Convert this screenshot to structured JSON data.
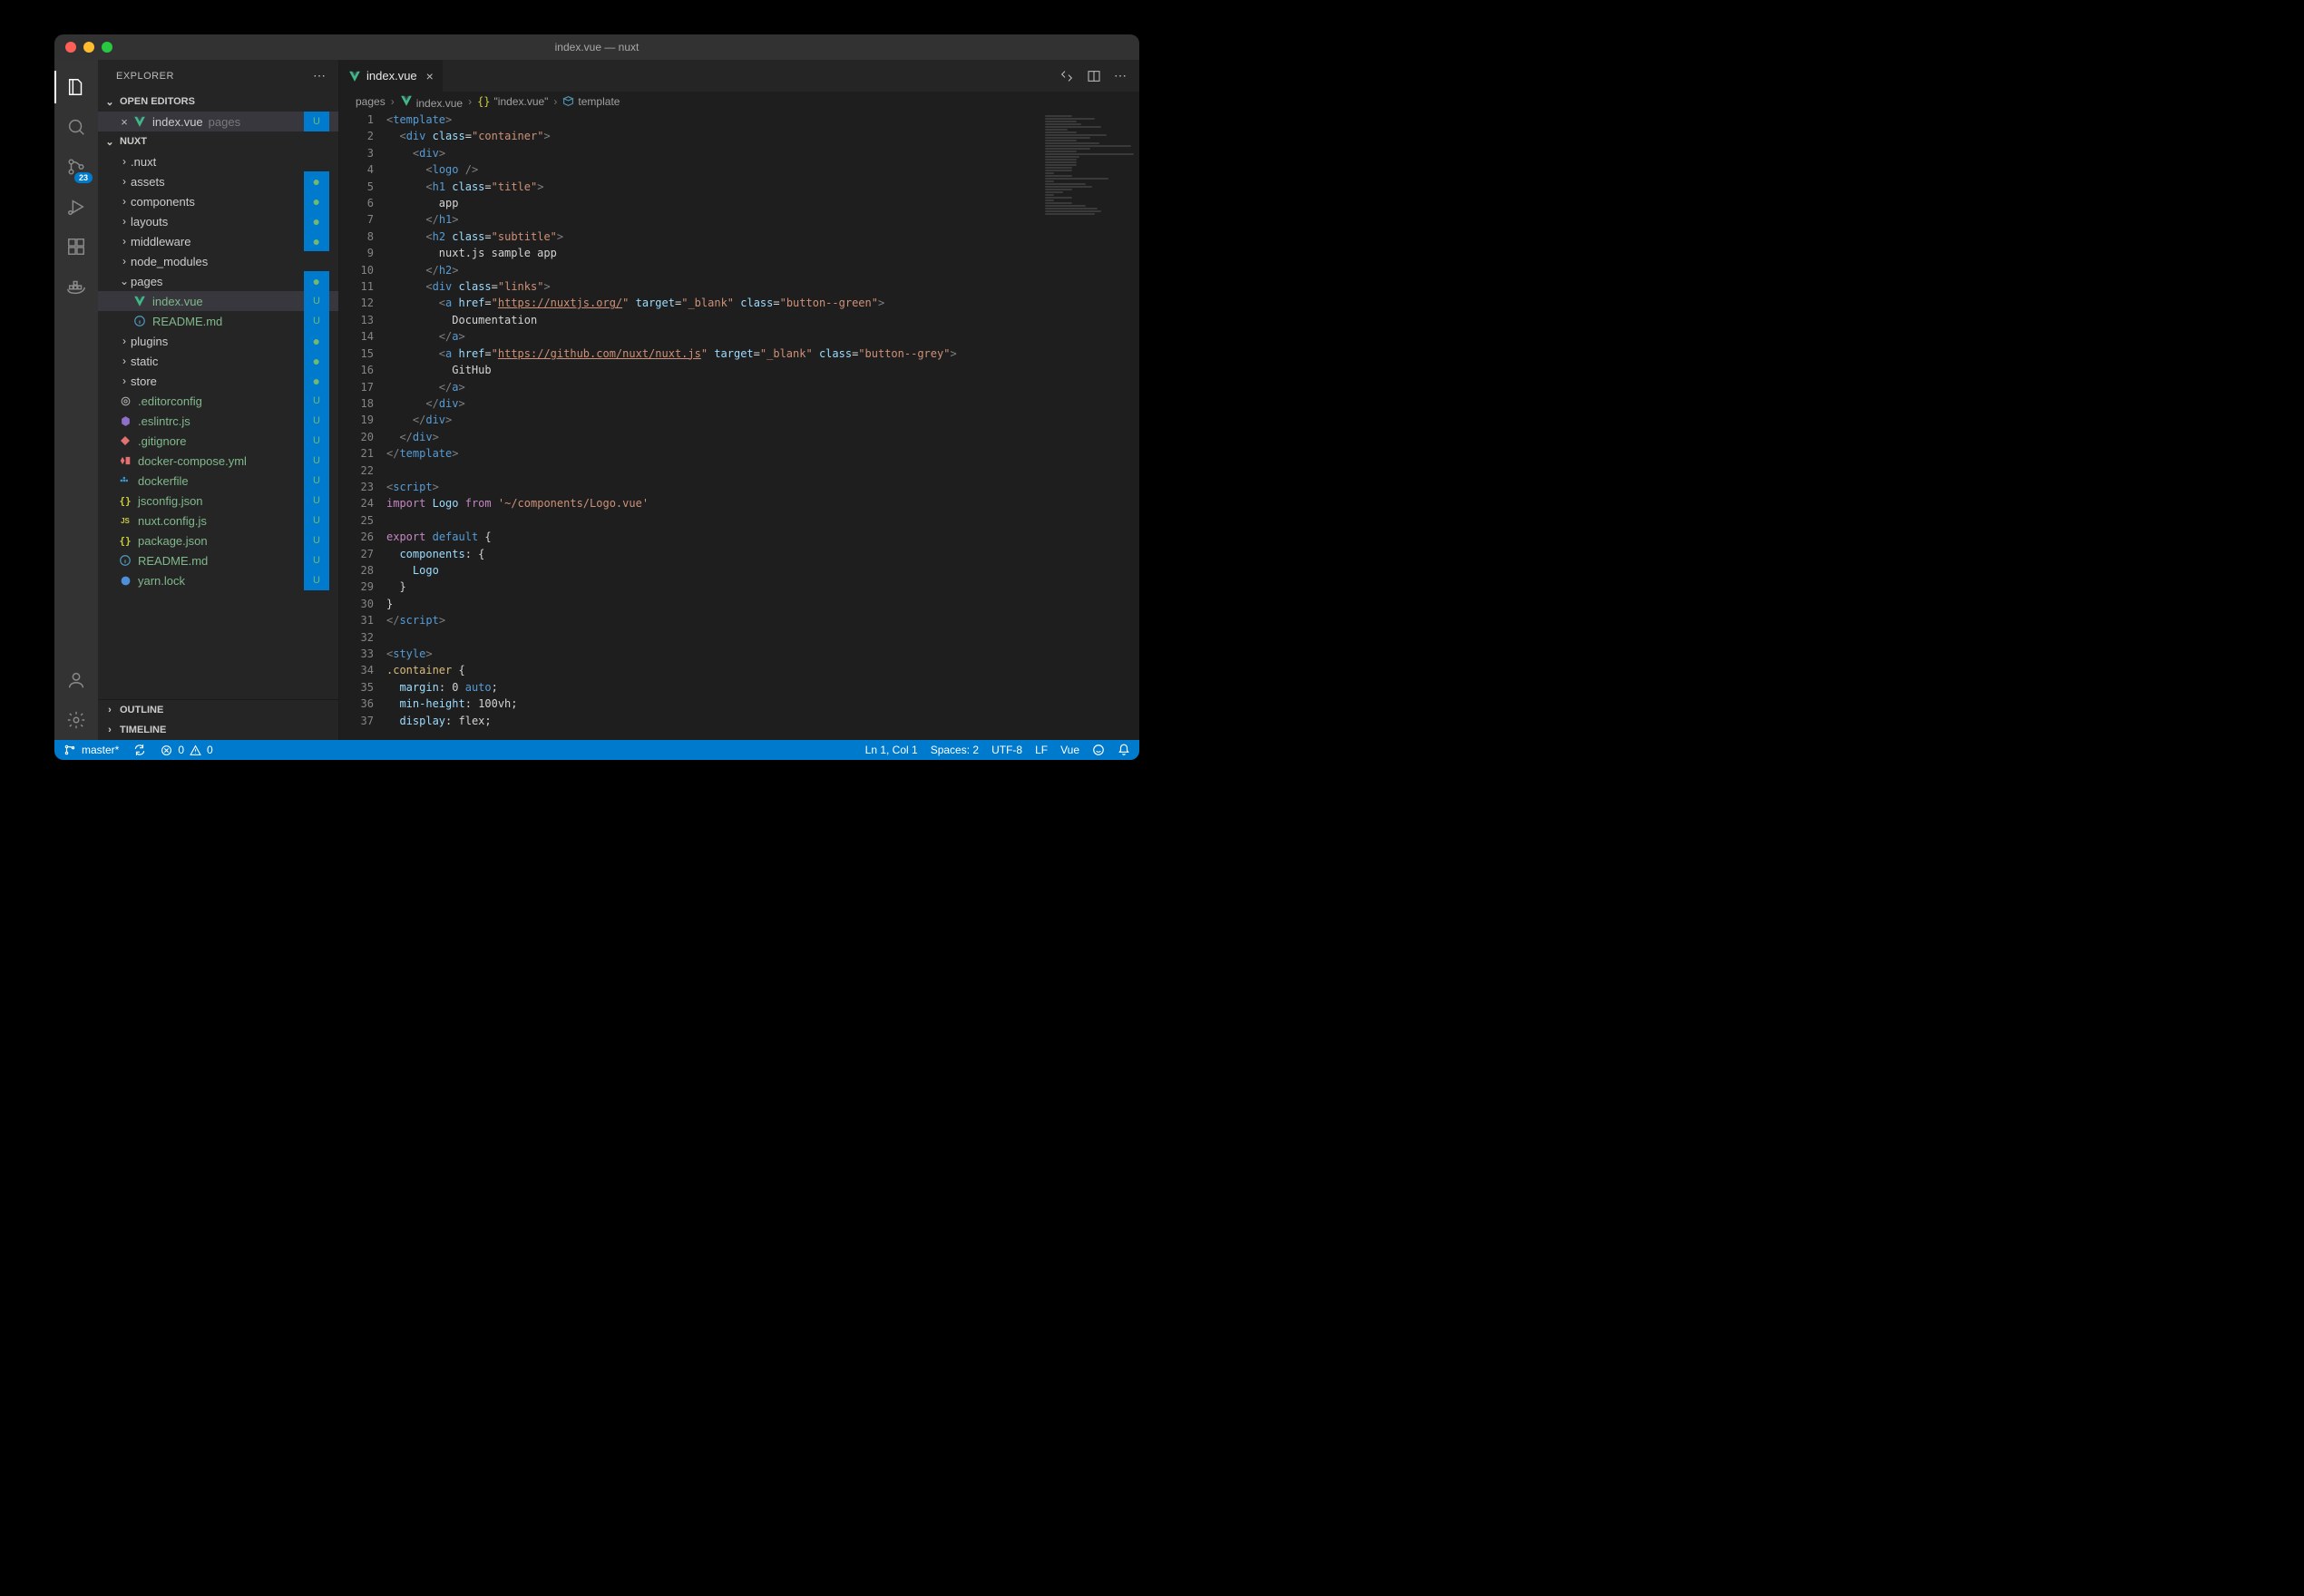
{
  "window": {
    "title": "index.vue — nuxt"
  },
  "sidebar": {
    "title": "EXPLORER",
    "open_editors_label": "OPEN EDITORS",
    "open_editors": [
      {
        "name": "index.vue",
        "dir": "pages",
        "status": "U"
      }
    ],
    "project_label": "NUXT",
    "tree": [
      {
        "kind": "folder",
        "name": ".nuxt",
        "depth": 1,
        "expanded": false
      },
      {
        "kind": "folder",
        "name": "assets",
        "depth": 1,
        "expanded": false,
        "dot": true
      },
      {
        "kind": "folder",
        "name": "components",
        "depth": 1,
        "expanded": false,
        "dot": true
      },
      {
        "kind": "folder",
        "name": "layouts",
        "depth": 1,
        "expanded": false,
        "dot": true
      },
      {
        "kind": "folder",
        "name": "middleware",
        "depth": 1,
        "expanded": false,
        "dot": true
      },
      {
        "kind": "folder",
        "name": "node_modules",
        "depth": 1,
        "expanded": false
      },
      {
        "kind": "folder",
        "name": "pages",
        "depth": 1,
        "expanded": true,
        "dot": true
      },
      {
        "kind": "file",
        "name": "index.vue",
        "depth": 2,
        "icon": "vue",
        "status": "U",
        "selected": true,
        "green": true
      },
      {
        "kind": "file",
        "name": "README.md",
        "depth": 2,
        "icon": "info",
        "status": "U",
        "green": true
      },
      {
        "kind": "folder",
        "name": "plugins",
        "depth": 1,
        "expanded": false,
        "dot": true
      },
      {
        "kind": "folder",
        "name": "static",
        "depth": 1,
        "expanded": false,
        "dot": true
      },
      {
        "kind": "folder",
        "name": "store",
        "depth": 1,
        "expanded": false,
        "dot": true
      },
      {
        "kind": "file",
        "name": ".editorconfig",
        "depth": 1,
        "icon": "editor",
        "status": "U",
        "green": true
      },
      {
        "kind": "file",
        "name": ".eslintrc.js",
        "depth": 1,
        "icon": "eslint",
        "status": "U",
        "green": true
      },
      {
        "kind": "file",
        "name": ".gitignore",
        "depth": 1,
        "icon": "git",
        "status": "U",
        "green": true
      },
      {
        "kind": "file",
        "name": "docker-compose.yml",
        "depth": 1,
        "icon": "yml",
        "status": "U",
        "green": true
      },
      {
        "kind": "file",
        "name": "dockerfile",
        "depth": 1,
        "icon": "docker",
        "status": "U",
        "green": true
      },
      {
        "kind": "file",
        "name": "jsconfig.json",
        "depth": 1,
        "icon": "json",
        "status": "U",
        "green": true
      },
      {
        "kind": "file",
        "name": "nuxt.config.js",
        "depth": 1,
        "icon": "js",
        "status": "U",
        "green": true
      },
      {
        "kind": "file",
        "name": "package.json",
        "depth": 1,
        "icon": "json",
        "status": "U",
        "green": true
      },
      {
        "kind": "file",
        "name": "README.md",
        "depth": 1,
        "icon": "info",
        "status": "U",
        "green": true
      },
      {
        "kind": "file",
        "name": "yarn.lock",
        "depth": 1,
        "icon": "yarn",
        "status": "U",
        "green": true
      }
    ],
    "outline_label": "OUTLINE",
    "timeline_label": "TIMELINE"
  },
  "activity": {
    "scm_badge": "23"
  },
  "tabs": {
    "open": {
      "name": "index.vue"
    }
  },
  "breadcrumbs": [
    "pages",
    "index.vue",
    "\"index.vue\"",
    "template"
  ],
  "code": {
    "lines": [
      [
        [
          "br",
          "<"
        ],
        [
          "tag",
          "template"
        ],
        [
          "br",
          ">"
        ]
      ],
      [
        [
          "txt",
          "  "
        ],
        [
          "br",
          "<"
        ],
        [
          "tag",
          "div"
        ],
        [
          "txt",
          " "
        ],
        [
          "attr",
          "class"
        ],
        [
          "pun",
          "="
        ],
        [
          "str",
          "\"container\""
        ],
        [
          "br",
          ">"
        ]
      ],
      [
        [
          "txt",
          "    "
        ],
        [
          "br",
          "<"
        ],
        [
          "tag",
          "div"
        ],
        [
          "br",
          ">"
        ]
      ],
      [
        [
          "txt",
          "      "
        ],
        [
          "br",
          "<"
        ],
        [
          "tag",
          "logo"
        ],
        [
          "txt",
          " "
        ],
        [
          "br",
          "/>"
        ]
      ],
      [
        [
          "txt",
          "      "
        ],
        [
          "br",
          "<"
        ],
        [
          "tag",
          "h1"
        ],
        [
          "txt",
          " "
        ],
        [
          "attr",
          "class"
        ],
        [
          "pun",
          "="
        ],
        [
          "str",
          "\"title\""
        ],
        [
          "br",
          ">"
        ]
      ],
      [
        [
          "txt",
          "        app"
        ]
      ],
      [
        [
          "txt",
          "      "
        ],
        [
          "br",
          "</"
        ],
        [
          "tag",
          "h1"
        ],
        [
          "br",
          ">"
        ]
      ],
      [
        [
          "txt",
          "      "
        ],
        [
          "br",
          "<"
        ],
        [
          "tag",
          "h2"
        ],
        [
          "txt",
          " "
        ],
        [
          "attr",
          "class"
        ],
        [
          "pun",
          "="
        ],
        [
          "str",
          "\"subtitle\""
        ],
        [
          "br",
          ">"
        ]
      ],
      [
        [
          "txt",
          "        nuxt.js sample app"
        ]
      ],
      [
        [
          "txt",
          "      "
        ],
        [
          "br",
          "</"
        ],
        [
          "tag",
          "h2"
        ],
        [
          "br",
          ">"
        ]
      ],
      [
        [
          "txt",
          "      "
        ],
        [
          "br",
          "<"
        ],
        [
          "tag",
          "div"
        ],
        [
          "txt",
          " "
        ],
        [
          "attr",
          "class"
        ],
        [
          "pun",
          "="
        ],
        [
          "str",
          "\"links\""
        ],
        [
          "br",
          ">"
        ]
      ],
      [
        [
          "txt",
          "        "
        ],
        [
          "br",
          "<"
        ],
        [
          "tag",
          "a"
        ],
        [
          "txt",
          " "
        ],
        [
          "attr",
          "href"
        ],
        [
          "pun",
          "="
        ],
        [
          "str",
          "\""
        ],
        [
          "link",
          "https://nuxtjs.org/"
        ],
        [
          "str",
          "\""
        ],
        [
          "txt",
          " "
        ],
        [
          "attr",
          "target"
        ],
        [
          "pun",
          "="
        ],
        [
          "str",
          "\"_blank\""
        ],
        [
          "txt",
          " "
        ],
        [
          "attr",
          "class"
        ],
        [
          "pun",
          "="
        ],
        [
          "str",
          "\"button--green\""
        ],
        [
          "br",
          ">"
        ]
      ],
      [
        [
          "txt",
          "          Documentation"
        ]
      ],
      [
        [
          "txt",
          "        "
        ],
        [
          "br",
          "</"
        ],
        [
          "tag",
          "a"
        ],
        [
          "br",
          ">"
        ]
      ],
      [
        [
          "txt",
          "        "
        ],
        [
          "br",
          "<"
        ],
        [
          "tag",
          "a"
        ],
        [
          "txt",
          " "
        ],
        [
          "attr",
          "href"
        ],
        [
          "pun",
          "="
        ],
        [
          "str",
          "\""
        ],
        [
          "link",
          "https://github.com/nuxt/nuxt.js"
        ],
        [
          "str",
          "\""
        ],
        [
          "txt",
          " "
        ],
        [
          "attr",
          "target"
        ],
        [
          "pun",
          "="
        ],
        [
          "str",
          "\"_blank\""
        ],
        [
          "txt",
          " "
        ],
        [
          "attr",
          "class"
        ],
        [
          "pun",
          "="
        ],
        [
          "str",
          "\"button--grey\""
        ],
        [
          "br",
          ">"
        ]
      ],
      [
        [
          "txt",
          "          GitHub"
        ]
      ],
      [
        [
          "txt",
          "        "
        ],
        [
          "br",
          "</"
        ],
        [
          "tag",
          "a"
        ],
        [
          "br",
          ">"
        ]
      ],
      [
        [
          "txt",
          "      "
        ],
        [
          "br",
          "</"
        ],
        [
          "tag",
          "div"
        ],
        [
          "br",
          ">"
        ]
      ],
      [
        [
          "txt",
          "    "
        ],
        [
          "br",
          "</"
        ],
        [
          "tag",
          "div"
        ],
        [
          "br",
          ">"
        ]
      ],
      [
        [
          "txt",
          "  "
        ],
        [
          "br",
          "</"
        ],
        [
          "tag",
          "div"
        ],
        [
          "br",
          ">"
        ]
      ],
      [
        [
          "br",
          "</"
        ],
        [
          "tag",
          "template"
        ],
        [
          "br",
          ">"
        ]
      ],
      [
        [
          "txt",
          ""
        ]
      ],
      [
        [
          "br",
          "<"
        ],
        [
          "tag",
          "script"
        ],
        [
          "br",
          ">"
        ]
      ],
      [
        [
          "imp",
          "import"
        ],
        [
          "txt",
          " "
        ],
        [
          "id",
          "Logo"
        ],
        [
          "txt",
          " "
        ],
        [
          "imp",
          "from"
        ],
        [
          "txt",
          " "
        ],
        [
          "str",
          "'~/components/Logo.vue'"
        ]
      ],
      [
        [
          "txt",
          ""
        ]
      ],
      [
        [
          "imp",
          "export"
        ],
        [
          "txt",
          " "
        ],
        [
          "kw",
          "default"
        ],
        [
          "txt",
          " "
        ],
        [
          "pun",
          "{"
        ]
      ],
      [
        [
          "txt",
          "  "
        ],
        [
          "id",
          "components"
        ],
        [
          "pun",
          ":"
        ],
        [
          "txt",
          " "
        ],
        [
          "pun",
          "{"
        ]
      ],
      [
        [
          "txt",
          "    "
        ],
        [
          "id",
          "Logo"
        ]
      ],
      [
        [
          "txt",
          "  "
        ],
        [
          "pun",
          "}"
        ]
      ],
      [
        [
          "pun",
          "}"
        ]
      ],
      [
        [
          "br",
          "</"
        ],
        [
          "tag",
          "script"
        ],
        [
          "br",
          ">"
        ]
      ],
      [
        [
          "txt",
          ""
        ]
      ],
      [
        [
          "br",
          "<"
        ],
        [
          "tag",
          "style"
        ],
        [
          "br",
          ">"
        ]
      ],
      [
        [
          "sel",
          ".container"
        ],
        [
          "txt",
          " "
        ],
        [
          "pun",
          "{"
        ]
      ],
      [
        [
          "txt",
          "  "
        ],
        [
          "attr",
          "margin"
        ],
        [
          "pun",
          ":"
        ],
        [
          "txt",
          " 0 "
        ],
        [
          "kw",
          "auto"
        ],
        [
          "pun",
          ";"
        ]
      ],
      [
        [
          "txt",
          "  "
        ],
        [
          "attr",
          "min-height"
        ],
        [
          "pun",
          ":"
        ],
        [
          "txt",
          " 100vh"
        ],
        [
          "pun",
          ";"
        ]
      ],
      [
        [
          "txt",
          "  "
        ],
        [
          "attr",
          "display"
        ],
        [
          "pun",
          ":"
        ],
        [
          "txt",
          " flex"
        ],
        [
          "pun",
          ";"
        ]
      ]
    ]
  },
  "statusbar": {
    "branch": "master*",
    "errors": "0",
    "warnings": "0",
    "cursor": "Ln 1, Col 1",
    "spaces": "Spaces: 2",
    "encoding": "UTF-8",
    "eol": "LF",
    "language": "Vue"
  }
}
